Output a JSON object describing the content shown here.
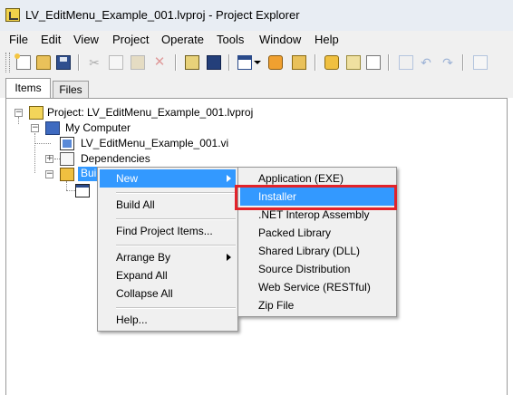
{
  "window": {
    "title": "LV_EditMenu_Example_001.lvproj - Project Explorer"
  },
  "menubar": {
    "items": [
      "File",
      "Edit",
      "View",
      "Project",
      "Operate",
      "Tools",
      "Window",
      "Help"
    ]
  },
  "toolbar": {
    "icons": [
      "new-icon",
      "open-icon",
      "save-all-icon",
      "cut-icon",
      "copy-icon",
      "paste-icon",
      "delete-icon",
      "build-icon",
      "save-icon",
      "view-icon",
      "dropdown-icon",
      "settings-icon",
      "items-icon",
      "add-icon",
      "refresh-icon",
      "undo-icon",
      "redo-icon",
      "add-file-icon"
    ]
  },
  "tabs": {
    "items_label": "Items",
    "files_label": "Files",
    "active": "Items"
  },
  "tree": {
    "project": "Project: LV_EditMenu_Example_001.lvproj",
    "my_computer": "My Computer",
    "vi": "LV_EditMenu_Example_001.vi",
    "dependencies": "Dependencies",
    "build_specs_partial": "Buil"
  },
  "context_menu": {
    "items": [
      "New",
      "Build All",
      "Find Project Items...",
      "Arrange By",
      "Expand All",
      "Collapse All",
      "Help..."
    ],
    "highlighted": "New"
  },
  "submenu": {
    "items": [
      "Application (EXE)",
      "Installer",
      ".NET Interop Assembly",
      "Packed Library",
      "Shared Library (DLL)",
      "Source Distribution",
      "Web Service (RESTful)",
      "Zip File"
    ],
    "highlighted": "Installer"
  },
  "colors": {
    "highlight": "#3399ff",
    "annotation_box": "#e2232a"
  }
}
